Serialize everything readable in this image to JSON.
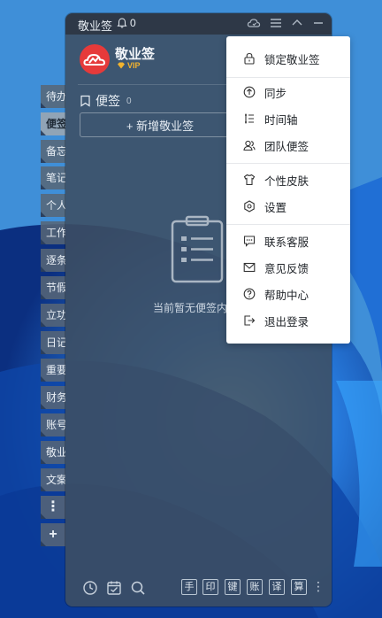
{
  "app": {
    "title": "敬业签",
    "reminder_count": "0",
    "profile": {
      "name": "敬业签",
      "badge": "VIP"
    },
    "section": {
      "title": "便签",
      "count": "0"
    },
    "new_note_label": "+ 新增敬业签",
    "empty_text": "当前暂无便签内容",
    "tabs": [
      {
        "label": "待办",
        "active": false
      },
      {
        "label": "便签",
        "active": true
      },
      {
        "label": "备忘",
        "active": false
      },
      {
        "label": "笔记",
        "active": false
      },
      {
        "label": "个人",
        "active": false
      },
      {
        "label": "工作",
        "active": false
      },
      {
        "label": "逐条",
        "active": false
      },
      {
        "label": "节假",
        "active": false
      },
      {
        "label": "立功",
        "active": false
      },
      {
        "label": "日记",
        "active": false
      },
      {
        "label": "重要",
        "active": false
      },
      {
        "label": "财务",
        "active": false
      },
      {
        "label": "账号",
        "active": false
      },
      {
        "label": "敬业",
        "active": false
      },
      {
        "label": "文案",
        "active": false
      },
      {
        "label": "⋮",
        "active": false
      },
      {
        "label": "+",
        "active": false
      }
    ],
    "bottom_tools": [
      "手",
      "印",
      "键",
      "账",
      "译",
      "算"
    ]
  },
  "menu": {
    "items": [
      {
        "label": "锁定敬业签",
        "icon": "lock-icon"
      },
      {
        "label": "同步",
        "icon": "sync-icon"
      },
      {
        "label": "时间轴",
        "icon": "timeline-icon"
      },
      {
        "label": "团队便签",
        "icon": "team-icon"
      },
      {
        "label": "个性皮肤",
        "icon": "skin-icon"
      },
      {
        "label": "设置",
        "icon": "settings-icon"
      },
      {
        "label": "联系客服",
        "icon": "chat-icon"
      },
      {
        "label": "意见反馈",
        "icon": "mail-icon"
      },
      {
        "label": "帮助中心",
        "icon": "help-icon"
      },
      {
        "label": "退出登录",
        "icon": "logout-icon"
      }
    ]
  },
  "colors": {
    "avatar": "#e63a3a",
    "vip": "#f2b32e",
    "panel": "#3e4e62",
    "menu_bg": "#ffffff"
  }
}
